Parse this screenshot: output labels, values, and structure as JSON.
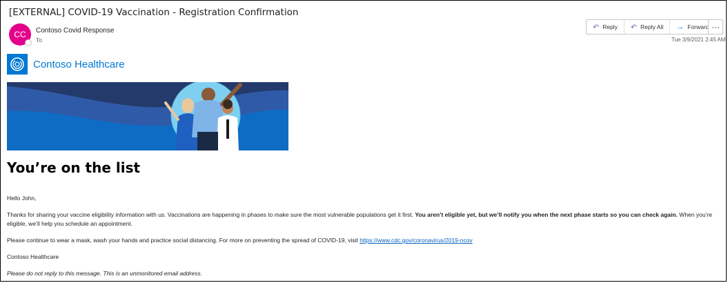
{
  "email": {
    "subject": "[EXTERNAL] COVID-19 Vaccination - Registration Confirmation",
    "avatar_initials": "CC",
    "sender": "Contoso Covid Response",
    "to_label": "To",
    "date": "Tue 3/9/2021 2:45 AM"
  },
  "actions": {
    "reply": "Reply",
    "reply_all": "Reply All",
    "forward": "Forward",
    "more": "···"
  },
  "body": {
    "brand": "Contoso Healthcare",
    "heading": "You’re on the list",
    "greeting": "Hello John,",
    "para1_start": "Thanks for sharing your vaccine eligibility information with us. Vaccinations are happening in phases to make sure the most vulnerable populations get it first. ",
    "para1_bold": "You aren’t eligible yet, but we’ll notify you when the next phase starts so you can check again.",
    "para1_end": " When you’re eligible, we’ll help you schedule an appointment.",
    "para2_text": "Please continue to wear a mask, wash your hands and practice social distancing. For more on preventing the spread of COVID-19, visit ",
    "para2_link": "https://www.cdc.gov/coronavirus/2019-ncov",
    "signature": "Contoso Healthcare",
    "disclaimer": "Please do not reply to this message. This is an unmonitored email address."
  },
  "colors": {
    "avatar": "#e3008c",
    "brand_blue": "#0078d4",
    "reply_icon": "#8764b8",
    "forward_icon": "#0078d4",
    "link": "#0563c1"
  }
}
